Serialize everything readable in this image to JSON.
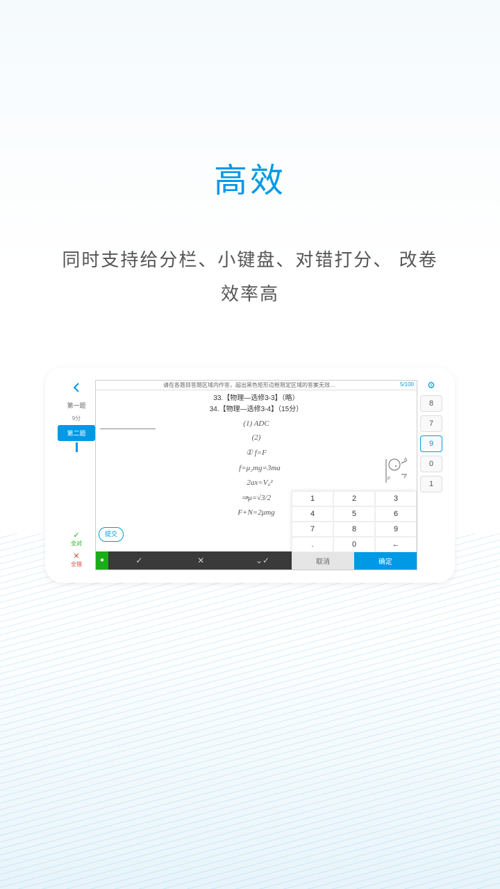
{
  "page": {
    "title": "高效",
    "subtitle_line1": "同时支持给分栏、小键盘、对错打分、",
    "subtitle_line2": "改卷效率高"
  },
  "sidebar": {
    "q1_label": "第一题",
    "q1_score": "9分",
    "q2_label": "第二题",
    "all_correct": "全对",
    "all_wrong": "全错"
  },
  "paper": {
    "header_text": "请在各题目答题区域内作答，超出黑色矩形边框限定区域的答案无效…",
    "progress": "5/100",
    "line33": "33.【物理—选修3-3】（略）",
    "line34": "34.【物理—选修3-4】（15分）",
    "ans1_label": "(1)",
    "ans1_val": "ADC",
    "ans2_label": "(2)",
    "hw1": "① f=F",
    "hw2": "f=μ₂mg=3ma",
    "hw3": "2ax=V₀²",
    "hw4": "⇒μ=√3/2",
    "hw5": "F+N=2μmg",
    "submit": "提交"
  },
  "keypad": {
    "k1": "1",
    "k2": "2",
    "k3": "3",
    "k4": "4",
    "k5": "5",
    "k6": "6",
    "k7": "7",
    "k8": "8",
    "k9": "9",
    "kdot": ".",
    "k0": "0",
    "kback": "←",
    "cancel": "取消",
    "ok": "确定"
  },
  "scores": {
    "s8": "8",
    "s7": "7",
    "s9": "9",
    "s0": "0",
    "s1": "1"
  }
}
